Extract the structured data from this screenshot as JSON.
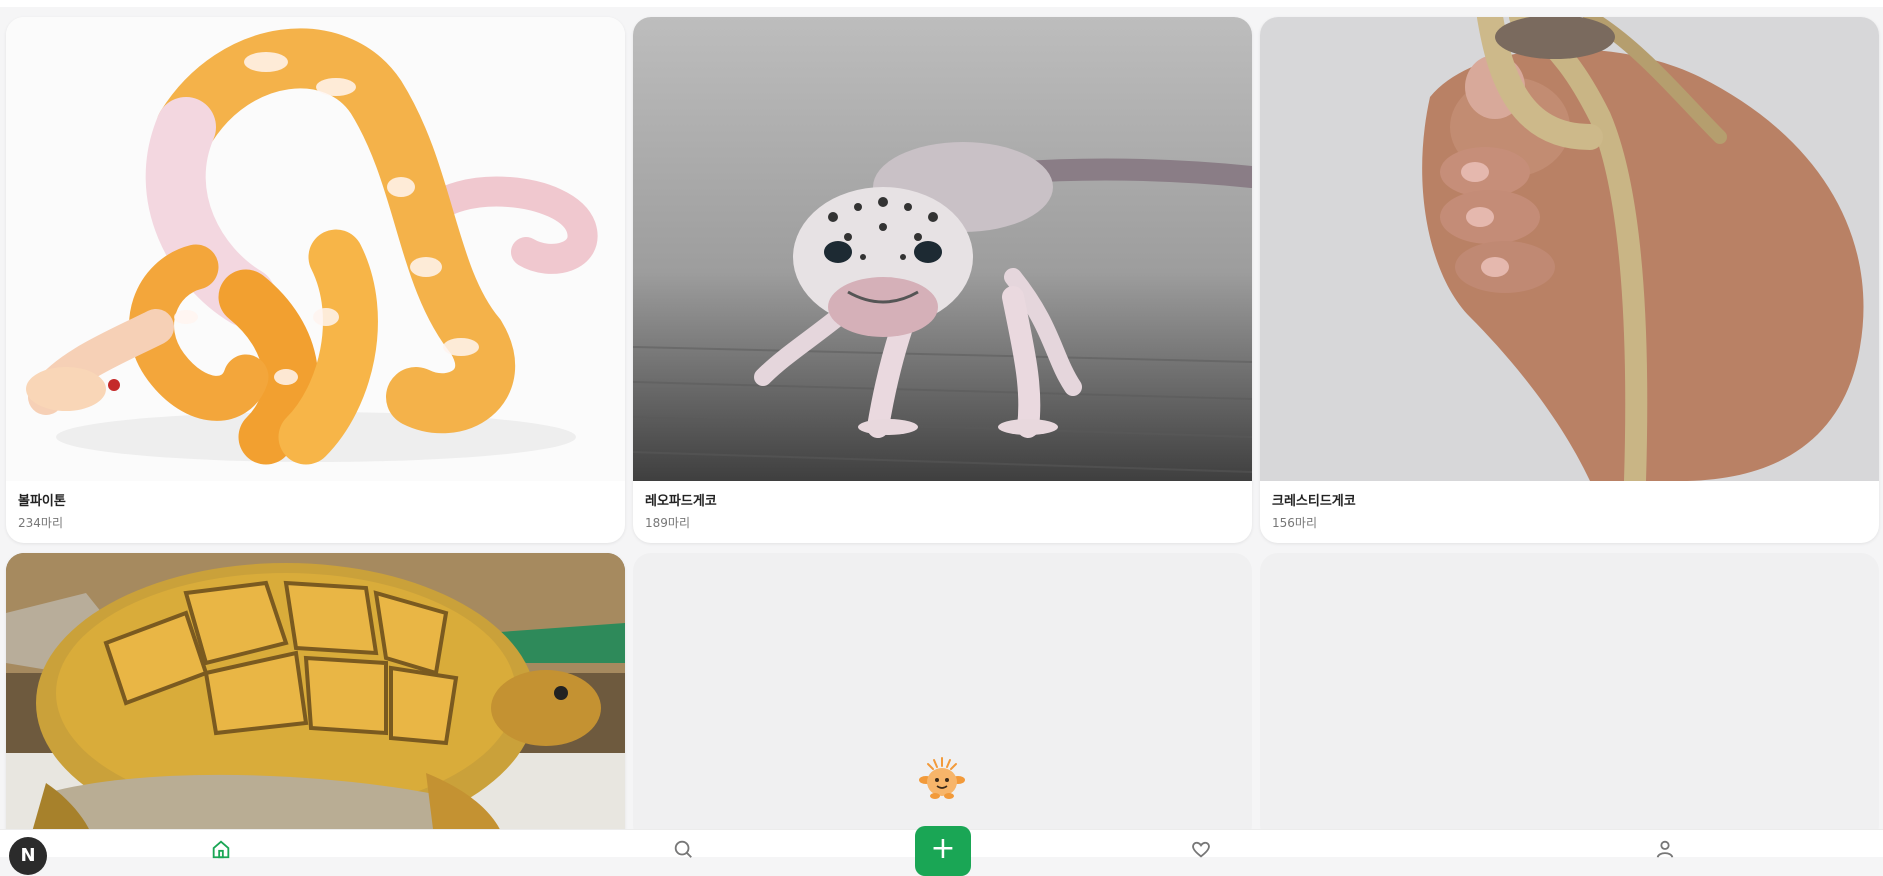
{
  "cards": [
    {
      "name": "볼파이톤",
      "count": "234마리",
      "image": "ball-python-photo"
    },
    {
      "name": "레오파드게코",
      "count": "189마리",
      "image": "leopard-gecko-photo"
    },
    {
      "name": "크레스티드게코",
      "count": "156마리",
      "image": "crested-gecko-photo"
    },
    {
      "name": "",
      "count": "",
      "image": "tortoise-photo"
    }
  ],
  "tabbar": {
    "avatar_initial": "N",
    "items": [
      "home-icon",
      "search-icon",
      "add-icon",
      "heart-icon",
      "profile-icon"
    ],
    "add_label": "+"
  },
  "colors": {
    "accent": "#1aa655",
    "background": "#f5f5f6"
  }
}
